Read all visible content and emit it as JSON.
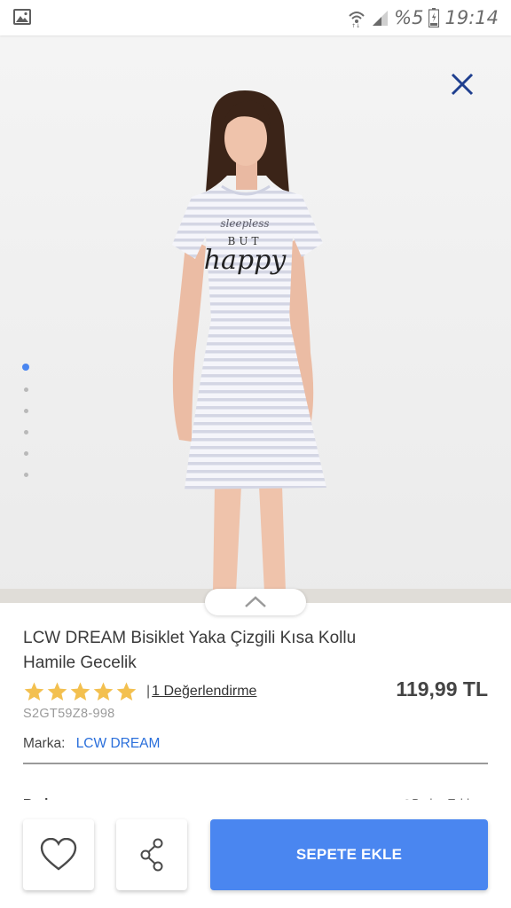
{
  "status_bar": {
    "battery": "%5",
    "time": "19:14",
    "icons": [
      "image-icon",
      "wifi-icon",
      "signal-icon",
      "battery-icon"
    ]
  },
  "hero": {
    "shirt_print": {
      "line1": "sleepless",
      "line2": "BUT",
      "line3": "happy"
    },
    "gallery_count": 6,
    "gallery_active": 1
  },
  "product": {
    "title": "LCW DREAM Bisiklet Yaka Çizgili Kısa Kollu Hamile Gecelik",
    "rating_stars": 5,
    "rating_separator": "|",
    "rating_link": "1 Değerlendirme",
    "price": "119,99 TL",
    "sku": "S2GT59Z8-998",
    "brand_label": "Marka:",
    "brand_value": "LCW DREAM",
    "size_label": "Beden",
    "size_table_link": "Beden Tablosu"
  },
  "actions": {
    "add_to_cart_label": "SEPETE EKLE"
  },
  "colors": {
    "accent": "#4a86f0",
    "brand_link": "#2a6fdb",
    "star": "#f3c04f",
    "close_icon": "#1f3f8f"
  }
}
